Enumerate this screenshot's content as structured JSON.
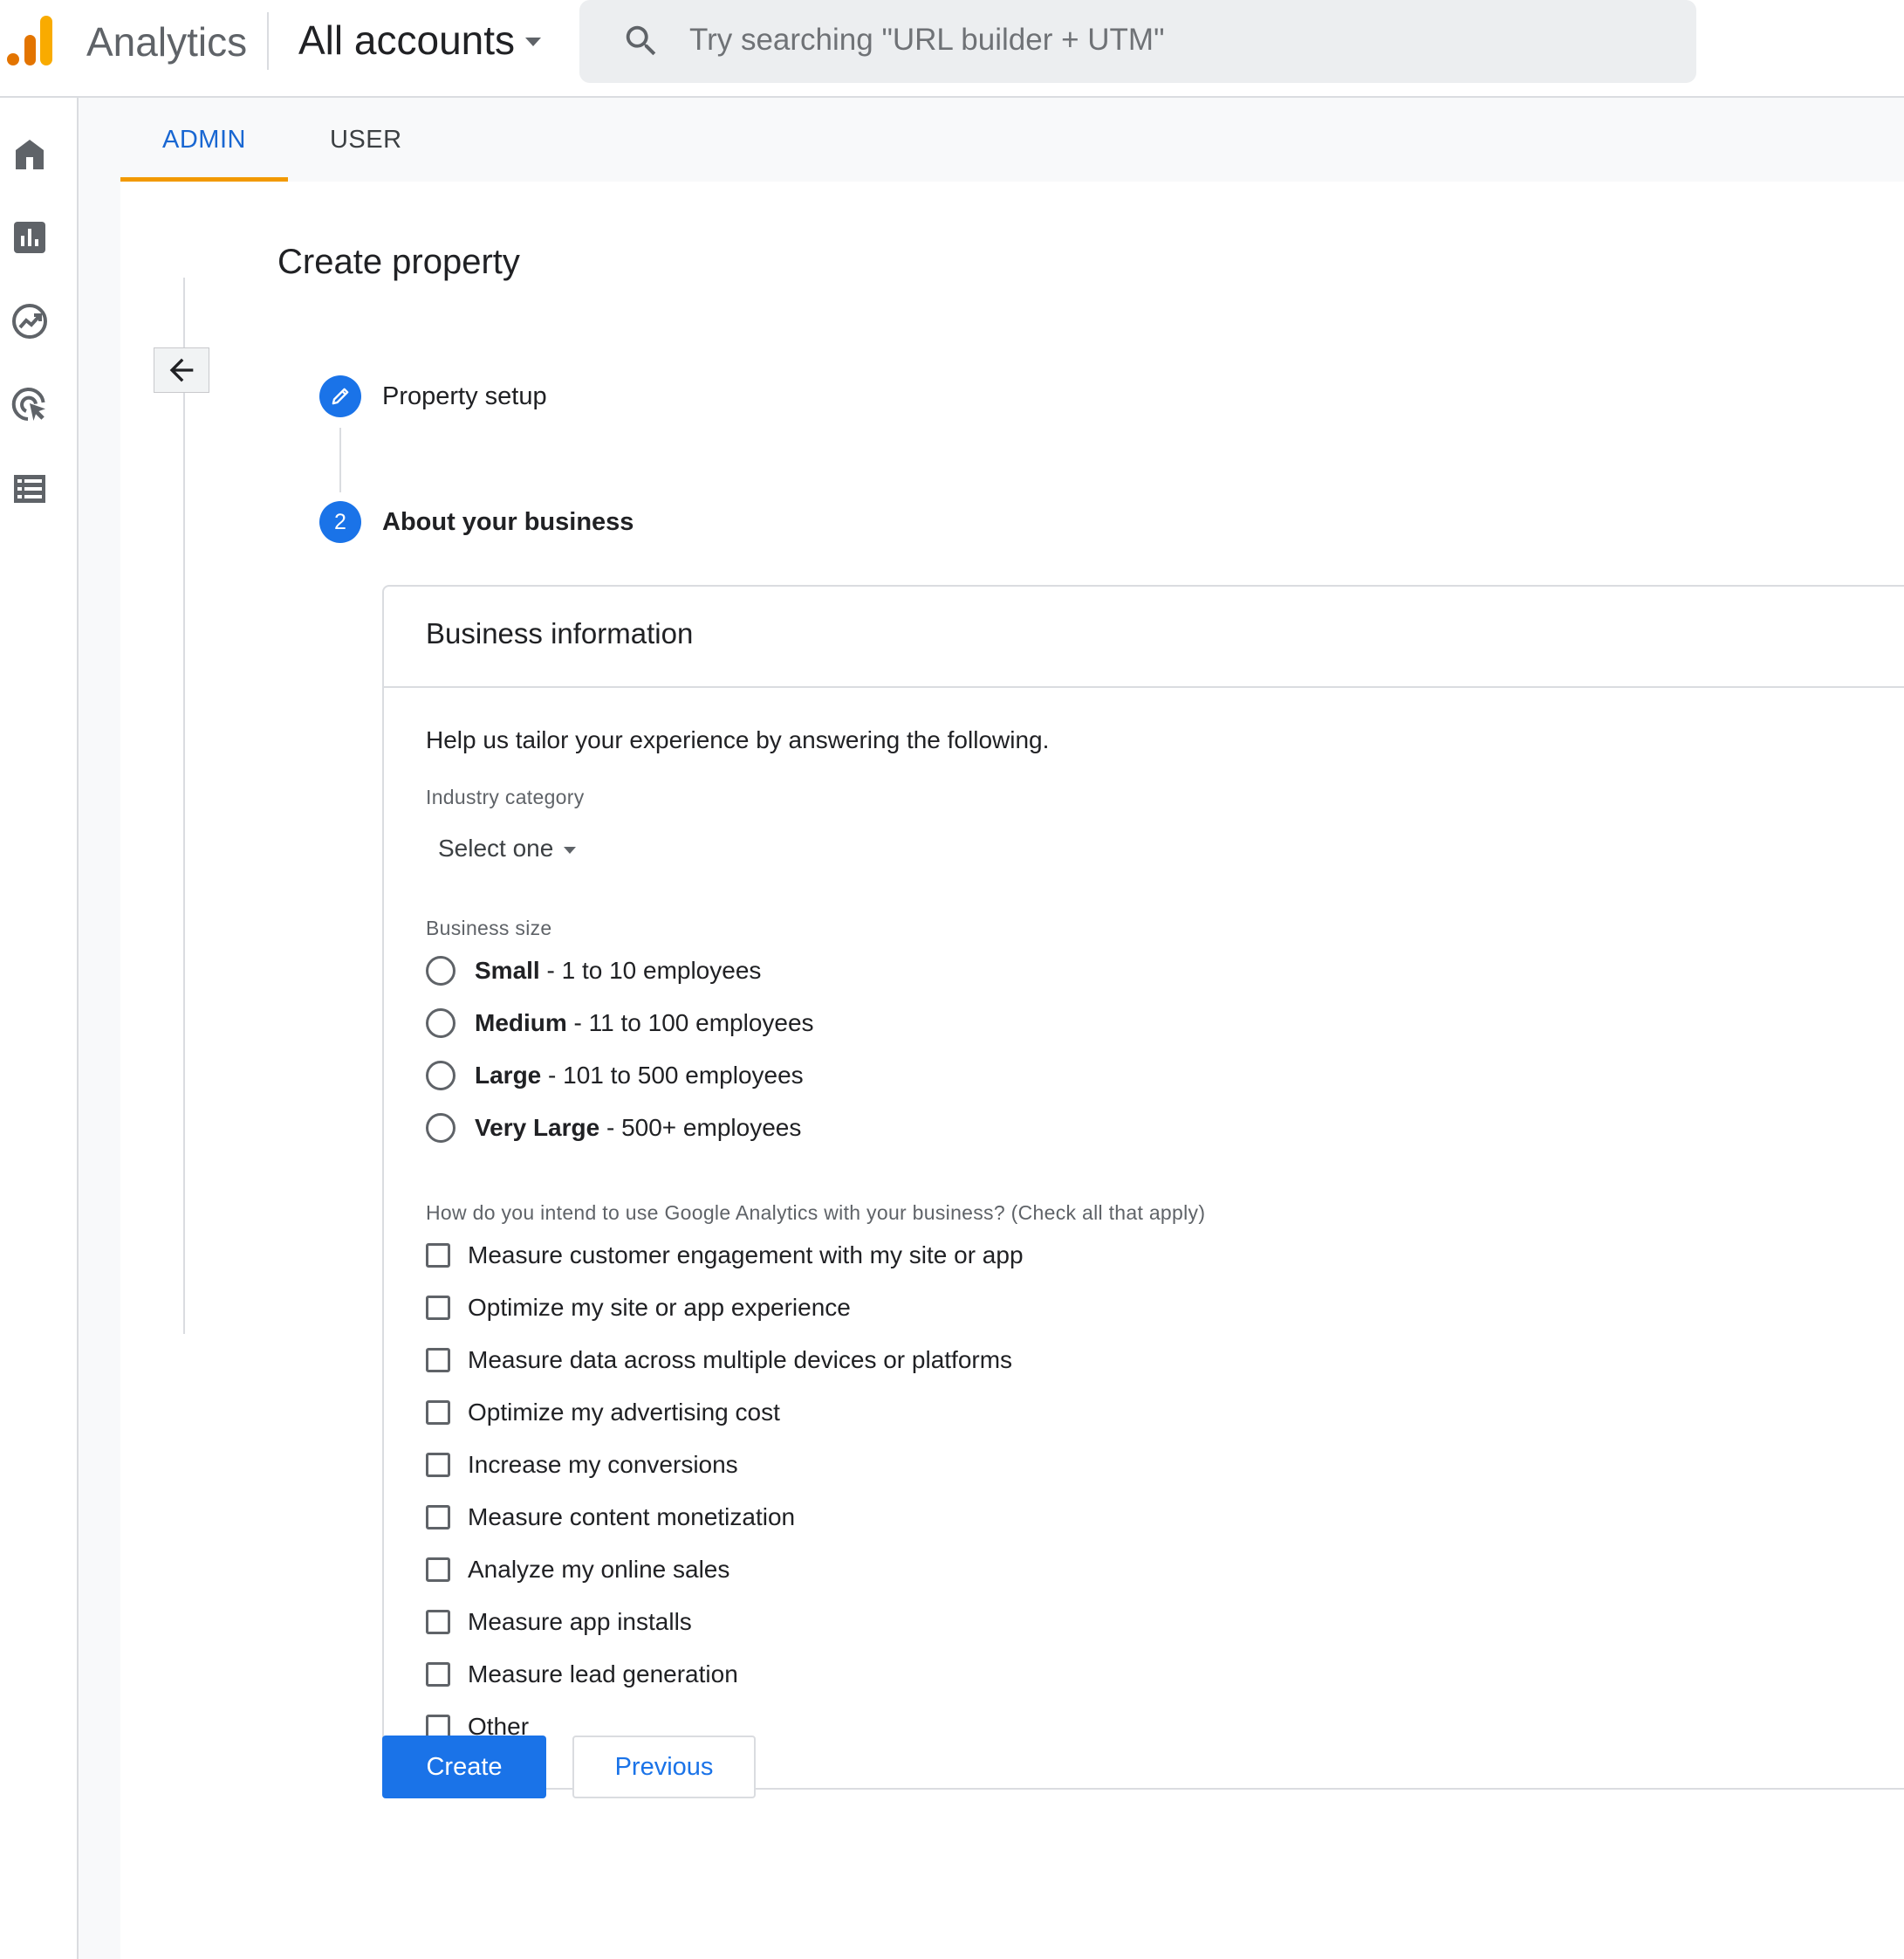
{
  "header": {
    "app_name": "Analytics",
    "account_selector": "All accounts",
    "search_placeholder": "Try searching \"URL builder + UTM\""
  },
  "left_nav": [
    "home-icon",
    "reports-icon",
    "explore-icon",
    "advertising-icon",
    "configure-icon"
  ],
  "tabs": [
    {
      "label": "ADMIN",
      "active": true
    },
    {
      "label": "USER",
      "active": false
    }
  ],
  "page": {
    "title": "Create property",
    "steps": [
      {
        "label": "Property setup",
        "state": "completed",
        "icon": "pencil-icon"
      },
      {
        "number": "2",
        "label": "About your business",
        "state": "current"
      }
    ]
  },
  "business_info": {
    "title": "Business information",
    "intro": "Help us tailor your experience by answering the following.",
    "industry_label": "Industry category",
    "industry_value": "Select one",
    "size_label": "Business size",
    "sizes": [
      {
        "name": "Small",
        "detail": " - 1 to 10 employees"
      },
      {
        "name": "Medium",
        "detail": " - 11 to 100 employees"
      },
      {
        "name": "Large",
        "detail": " - 101 to 500 employees"
      },
      {
        "name": "Very Large",
        "detail": " - 500+ employees"
      }
    ],
    "intent_label": "How do you intend to use Google Analytics with your business? (Check all that apply)",
    "intents": [
      "Measure customer engagement with my site or app",
      "Optimize my site or app experience",
      "Measure data across multiple devices or platforms",
      "Optimize my advertising cost",
      "Increase my conversions",
      "Measure content monetization",
      "Analyze my online sales",
      "Measure app installs",
      "Measure lead generation",
      "Other"
    ]
  },
  "actions": {
    "create": "Create",
    "previous": "Previous"
  },
  "colors": {
    "accent": "#1a73e8",
    "tab_indicator": "#f29900",
    "logo_orange_dark": "#e37400",
    "logo_orange_light": "#f9ab00"
  }
}
